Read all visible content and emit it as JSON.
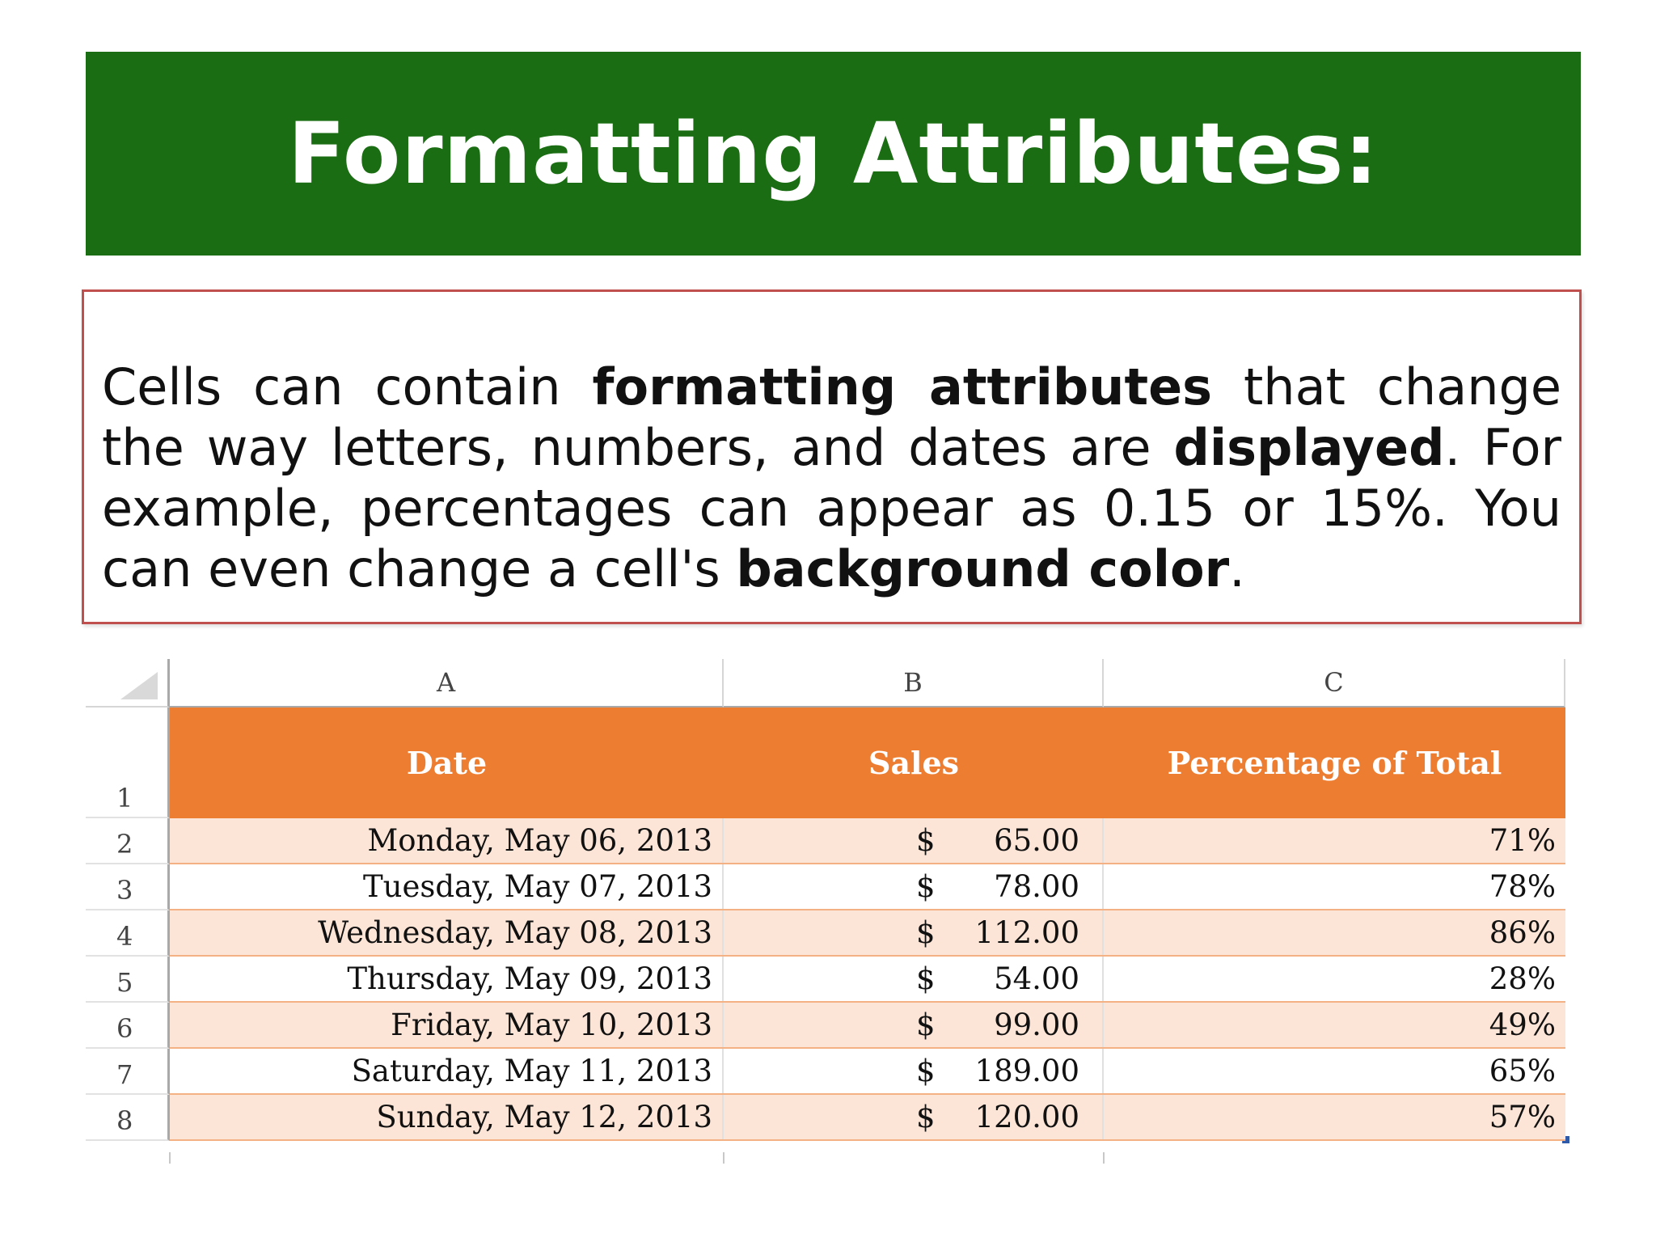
{
  "slide": {
    "title": "Formatting Attributes:",
    "paragraph": [
      {
        "text": "Cells can contain ",
        "bold": false
      },
      {
        "text": "formatting attributes",
        "bold": true
      },
      {
        "text": " that change the way letters, numbers, and dates are ",
        "bold": false
      },
      {
        "text": "displayed",
        "bold": true
      },
      {
        "text": ". For example, percentages can appear as 0.15 or 15%. You can even change a cell's ",
        "bold": false
      },
      {
        "text": "background color",
        "bold": true
      },
      {
        "text": ".",
        "bold": false
      }
    ]
  },
  "spreadsheet": {
    "columns": [
      "A",
      "B",
      "C"
    ],
    "header_row_number": "1",
    "headers": [
      "Date",
      "Sales",
      "Percentage of Total"
    ],
    "rows": [
      {
        "n": "2",
        "date": "Monday, May 06, 2013",
        "cur": "$",
        "amount": "65.00",
        "pct": "71%"
      },
      {
        "n": "3",
        "date": "Tuesday, May 07, 2013",
        "cur": "$",
        "amount": "78.00",
        "pct": "78%"
      },
      {
        "n": "4",
        "date": "Wednesday, May 08, 2013",
        "cur": "$",
        "amount": "112.00",
        "pct": "86%"
      },
      {
        "n": "5",
        "date": "Thursday, May 09, 2013",
        "cur": "$",
        "amount": "54.00",
        "pct": "28%"
      },
      {
        "n": "6",
        "date": "Friday, May 10, 2013",
        "cur": "$",
        "amount": "99.00",
        "pct": "49%"
      },
      {
        "n": "7",
        "date": "Saturday, May 11, 2013",
        "cur": "$",
        "amount": "189.00",
        "pct": "65%"
      },
      {
        "n": "8",
        "date": "Sunday, May 12, 2013",
        "cur": "$",
        "amount": "120.00",
        "pct": "57%"
      }
    ]
  },
  "colors": {
    "title_band": "#1a6d12",
    "box_border": "#c0504d",
    "header_fill": "#ed7d31",
    "band_fill": "#fce4d6"
  }
}
